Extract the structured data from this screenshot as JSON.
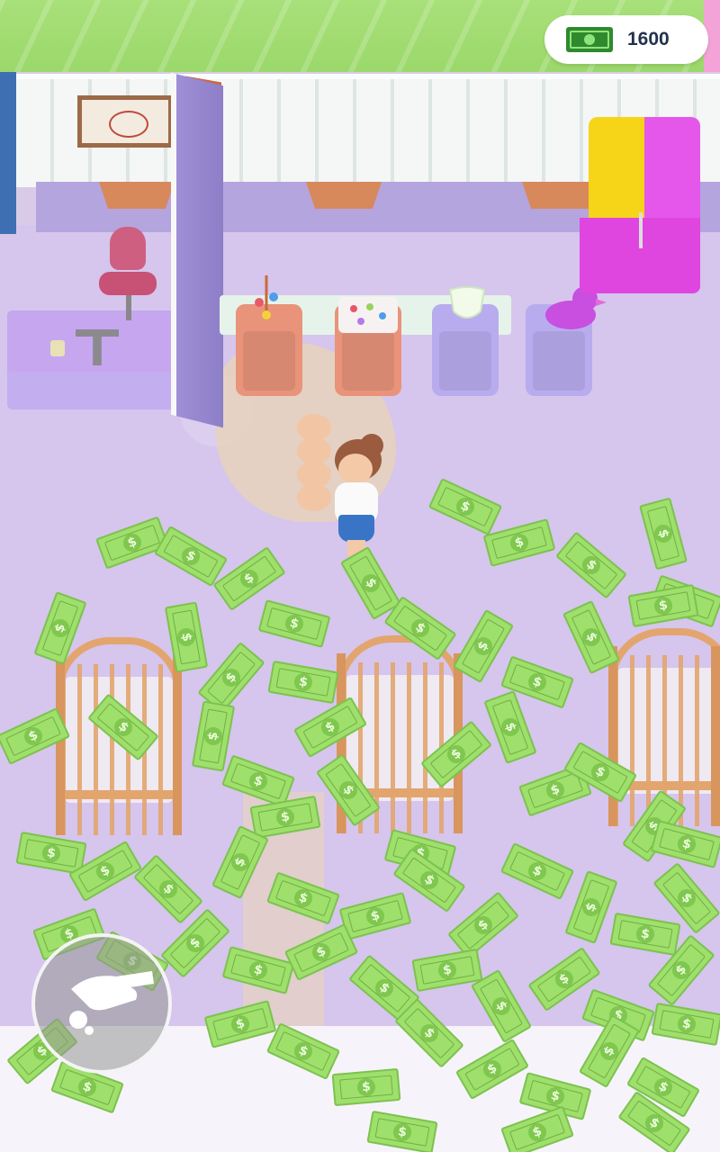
{
  "hud": {
    "cash_amount": "1600",
    "cash_icon": "cash-banknote-icon",
    "action_button_icon": "hand-dropping-icon"
  },
  "colors": {
    "money_green": "#9fdf6c",
    "cash_icon_green": "#2f8a2e",
    "floor_lavender": "#d6c5ec",
    "fridge_yellow": "#f6d417",
    "fridge_magenta": "#e457ea"
  },
  "bill_symbol": "$"
}
